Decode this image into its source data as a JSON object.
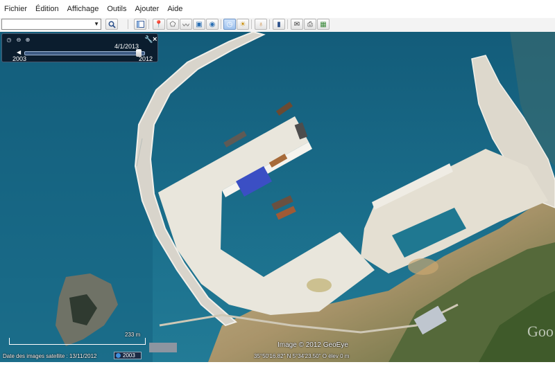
{
  "menu": [
    "Fichier",
    "Édition",
    "Affichage",
    "Outils",
    "Ajouter",
    "Aide"
  ],
  "search": {
    "value": "",
    "placeholder": ""
  },
  "toolbar": {
    "search_button": "search-icon",
    "tools": [
      "sidebar-icon",
      "placemark-icon",
      "polygon-icon",
      "path-icon",
      "overlay-icon",
      "tour-icon",
      "history-icon",
      "sun-icon",
      "planets-icon",
      "ruler-icon",
      "email-icon",
      "print-icon",
      "maps-icon"
    ]
  },
  "timeslider": {
    "date": "4/1/2013",
    "start": "2003",
    "end": "2012",
    "position": 0.96
  },
  "statusbar": {
    "imagery_date": "Date des images satellite : 13/11/2012",
    "history_year": "2003",
    "copyright": "Image © 2012 GeoEye",
    "coordinates": "35°50'16.82\" N   5°34'23.50\" O   élev    0 m",
    "scale": "233 m"
  },
  "logo": "Goo",
  "colors": {
    "sea": "#1d6f8a",
    "deep_sea": "#0f5470",
    "quay": "#e9e6dc"
  }
}
